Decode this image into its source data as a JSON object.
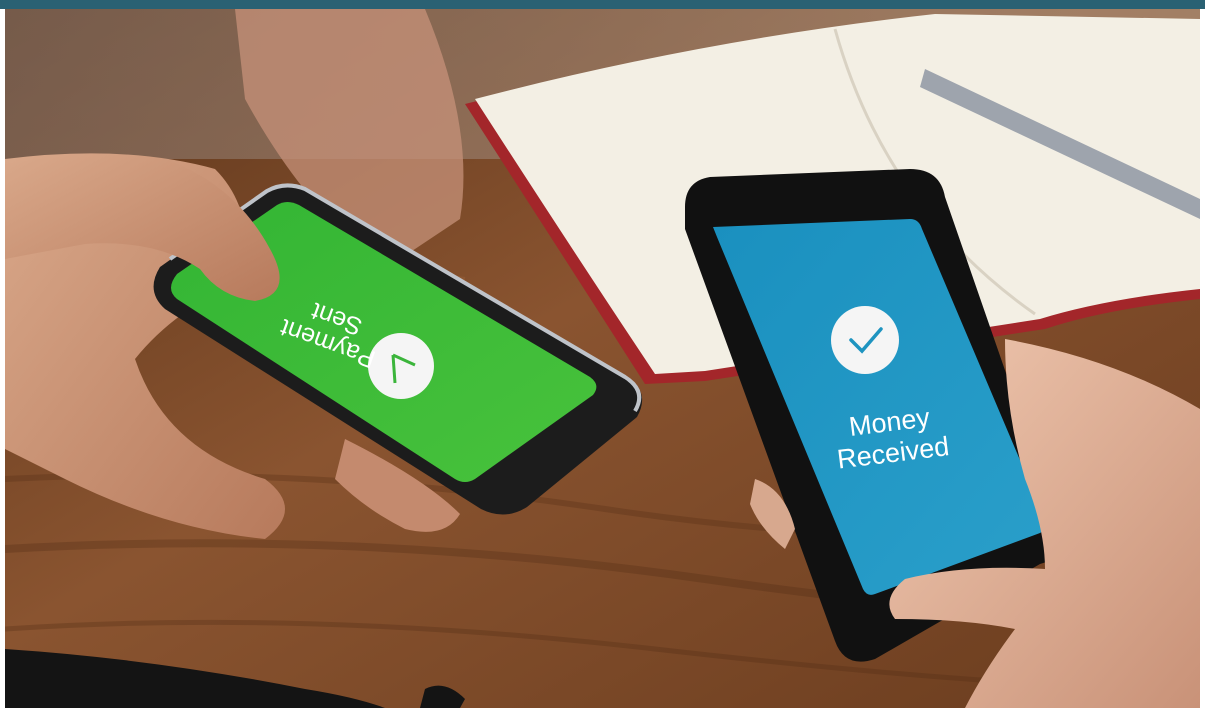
{
  "scene": {
    "description_icon": "photo",
    "colors": {
      "top_bar": "#2a6173",
      "green_screen": "#3cb83c",
      "blue_screen": "#1e94c0",
      "table": "#7a4524",
      "notebook": "#f4f0e6"
    }
  },
  "left_phone": {
    "line1": "Payment",
    "line2": "Sent"
  },
  "right_phone": {
    "line1": "Money",
    "line2": "Received"
  }
}
